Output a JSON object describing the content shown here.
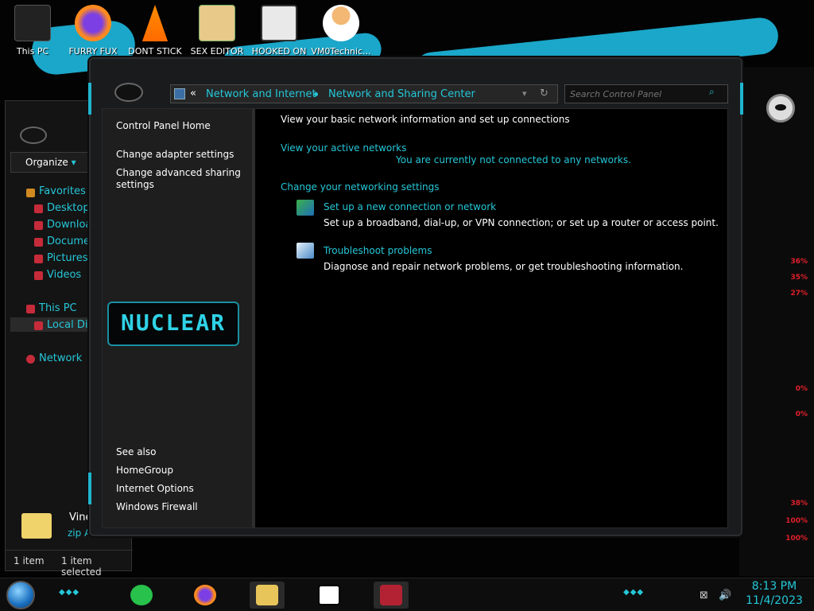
{
  "desktop": {
    "icons": [
      {
        "label": "This PC",
        "icon": "this-pc-icon"
      },
      {
        "label": "FURRY FUX",
        "icon": "firefox-icon"
      },
      {
        "label": "DONT STICK",
        "icon": "vlc-icon"
      },
      {
        "label": "SEX EDITOR",
        "icon": "hxd-icon"
      },
      {
        "label": "HOOKED ON",
        "icon": "app-icon"
      },
      {
        "label": "VM0Technic...",
        "icon": "user-icon"
      }
    ]
  },
  "bg_explorer": {
    "organize_label": "Organize",
    "nav": [
      {
        "label": "Favorites"
      },
      {
        "label": "Desktop"
      },
      {
        "label": "Downloa"
      },
      {
        "label": "Documen"
      },
      {
        "label": "Pictures"
      },
      {
        "label": "Videos"
      },
      {
        "label": "This PC"
      },
      {
        "label": "Local Dis"
      },
      {
        "label": "Network"
      }
    ],
    "file_name": "Vine",
    "file_type": "zip Arc",
    "status_count": "1 item",
    "status_selected": "1 item selected"
  },
  "address_bar": {
    "back_chevron": "«",
    "crumbs": [
      "Network and Internet",
      "Network and Sharing Center"
    ],
    "search_placeholder": "Search Control Panel"
  },
  "left_pane": {
    "links": [
      "Control Panel Home",
      "Change adapter settings",
      "Change advanced sharing settings"
    ],
    "banner_text": "NUCLEAR",
    "see_also_title": "See also",
    "see_also": [
      "HomeGroup",
      "Internet Options",
      "Windows Firewall"
    ]
  },
  "content": {
    "heading": "View your basic network information and set up connections",
    "active_networks_label": "View your active networks",
    "no_network_text": "You are currently not connected to any networks.",
    "change_settings_label": "Change your networking settings",
    "tasks": [
      {
        "title": "Set up a new connection or network",
        "description": "Set up a broadband, dial-up, or VPN connection; or set up a router or access point.",
        "icon": "network-setup-icon"
      },
      {
        "title": "Troubleshoot problems",
        "description": "Diagnose and repair network problems, or get troubleshooting information.",
        "icon": "troubleshoot-icon"
      }
    ]
  },
  "gauge": {
    "readings": [
      "36%",
      "35%",
      "27%",
      "0%",
      "0%",
      "38%",
      "100%",
      "100%"
    ]
  },
  "taskbar": {
    "time": "8:13 PM",
    "date": "11/4/2023",
    "apps": [
      "notes",
      "firefox",
      "file-explorer",
      "7-zip",
      "game"
    ]
  },
  "colors": {
    "accent": "#25c7d8",
    "background": "#000000",
    "panel": "#1e1e1e",
    "gauge_red": "#e21f2a"
  }
}
